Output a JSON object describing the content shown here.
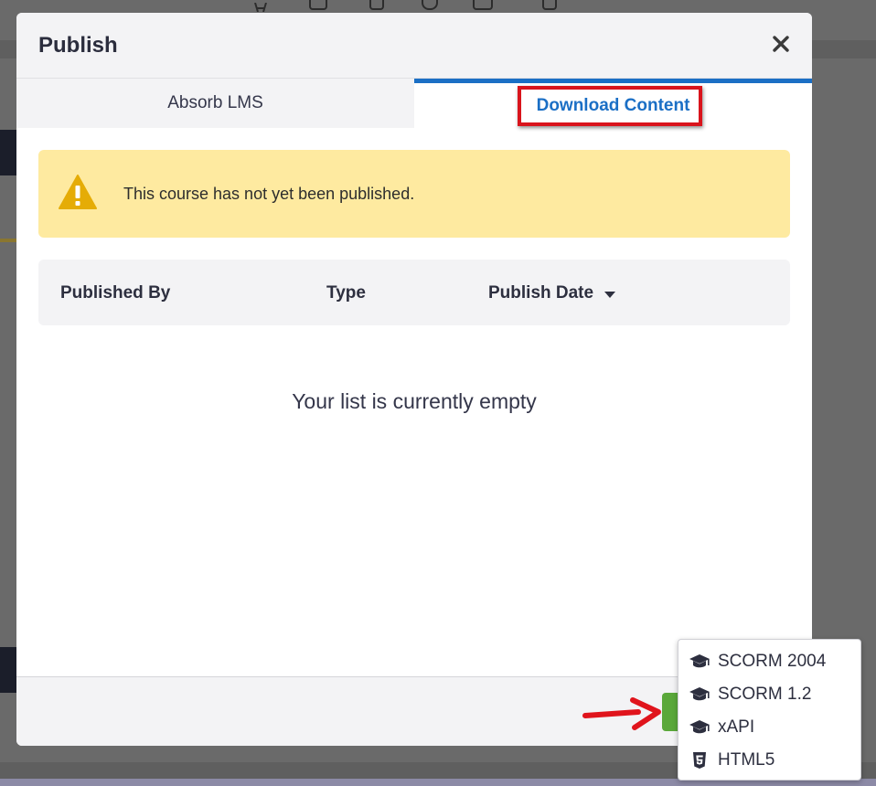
{
  "modal": {
    "title": "Publish",
    "tabs": [
      {
        "label": "Absorb LMS",
        "active": false
      },
      {
        "label": "Download Content",
        "active": true
      }
    ],
    "alert": {
      "text": "This course has not yet been published."
    },
    "table": {
      "columns": [
        "Published By",
        "Type",
        "Publish Date"
      ],
      "sort_column": "Publish Date",
      "sort_direction": "desc"
    },
    "empty_message": "Your list is currently empty"
  },
  "dropdown": {
    "items": [
      {
        "label": "SCORM 2004",
        "icon": "graduation-cap-icon"
      },
      {
        "label": "SCORM 1.2",
        "icon": "graduation-cap-icon"
      },
      {
        "label": "xAPI",
        "icon": "graduation-cap-icon"
      },
      {
        "label": "HTML5",
        "icon": "html5-icon"
      }
    ]
  },
  "colors": {
    "accent": "#1b6fc5",
    "highlight": "#d9141c",
    "alert_bg": "#feeaa0",
    "warning_icon": "#e5ac06",
    "publish_button": "#5aa83a"
  }
}
